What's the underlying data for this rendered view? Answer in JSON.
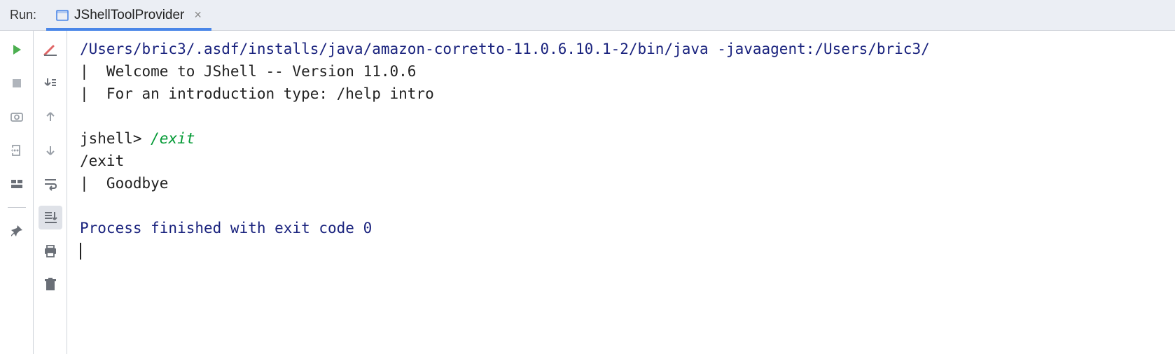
{
  "header": {
    "run_label": "Run:",
    "tab_name": "JShellToolProvider"
  },
  "console": {
    "cmd": "/Users/bric3/.asdf/installs/java/amazon-corretto-11.0.6.10.1-2/bin/java -javaagent:/Users/bric3/",
    "welcome1": "|  Welcome to JShell -- Version 11.0.6",
    "welcome2": "|  For an introduction type: /help intro",
    "prompt": "jshell> ",
    "entered": "/exit",
    "echo": "/exit",
    "goodbye": "|  Goodbye",
    "finished": "Process finished with exit code 0"
  }
}
